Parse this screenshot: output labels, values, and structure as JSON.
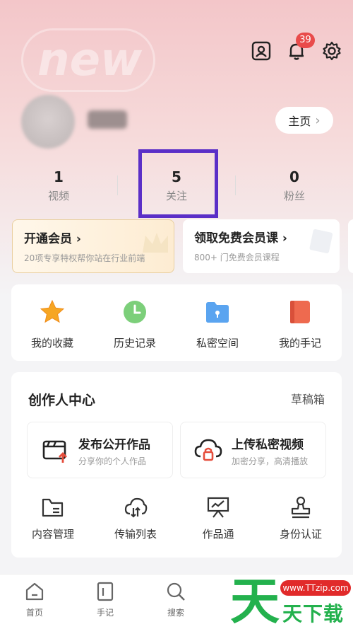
{
  "header": {
    "notification_count": "39",
    "home_button_label": "主页",
    "home_button_chevron": "›"
  },
  "stats": [
    {
      "value": "1",
      "label": "视频"
    },
    {
      "value": "5",
      "label": "关注"
    },
    {
      "value": "0",
      "label": "粉丝"
    }
  ],
  "promos": [
    {
      "title": "开通会员 ›",
      "subtitle": "20项专享特权帮你站在行业前端"
    },
    {
      "title": "领取免费会员课 ›",
      "subtitle": "800+ 门免费会员课程"
    }
  ],
  "quick_access": [
    {
      "label": "我的收藏",
      "icon": "star-icon"
    },
    {
      "label": "历史记录",
      "icon": "clock-icon"
    },
    {
      "label": "私密空间",
      "icon": "private-folder-icon"
    },
    {
      "label": "我的手记",
      "icon": "notebook-icon"
    }
  ],
  "creator": {
    "title": "创作人中心",
    "drafts_label": "草稿箱",
    "actions": [
      {
        "title": "发布公开作品",
        "subtitle": "分享你的个人作品",
        "icon": "clapperboard-upload-icon"
      },
      {
        "title": "上传私密视频",
        "subtitle": "加密分享，高清播放",
        "icon": "cloud-lock-icon"
      }
    ],
    "tools": [
      {
        "label": "内容管理",
        "icon": "folder-list-icon"
      },
      {
        "label": "传输列表",
        "icon": "cloud-transfer-icon"
      },
      {
        "label": "作品通",
        "icon": "presentation-chart-icon"
      },
      {
        "label": "身份认证",
        "icon": "stamp-icon"
      }
    ]
  },
  "bottom_nav": [
    {
      "label": "首页",
      "icon": "home-icon"
    },
    {
      "label": "手记",
      "icon": "note-icon"
    },
    {
      "label": "搜索",
      "icon": "search-icon"
    }
  ],
  "watermark": {
    "badge_text": "new",
    "site_url": "www.TTzip.com",
    "big_char": "天",
    "brand_text": "天下载"
  },
  "colors": {
    "accent_highlight": "#5b2fc7",
    "badge_red": "#e94b4b",
    "brand_green": "#23b14d"
  }
}
